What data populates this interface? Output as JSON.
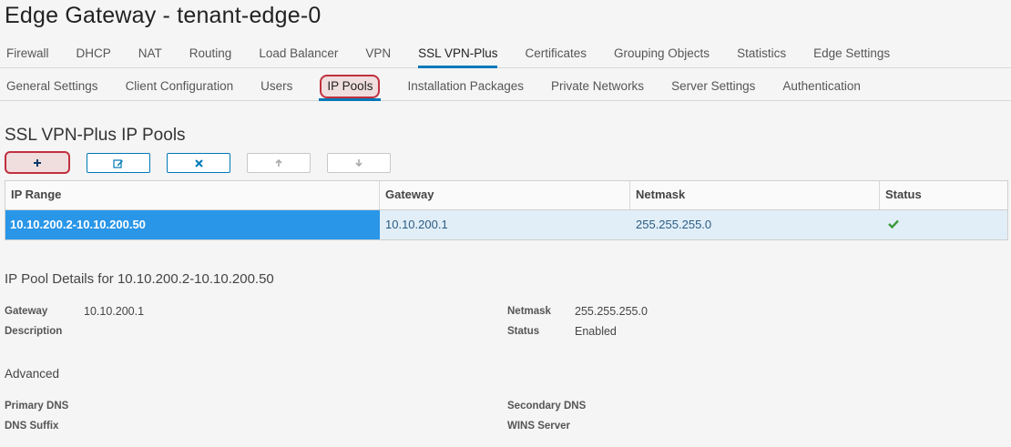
{
  "window": {
    "title": "Edge Gateway - tenant-edge-0"
  },
  "primary_tabs": [
    {
      "label": "Firewall"
    },
    {
      "label": "DHCP"
    },
    {
      "label": "NAT"
    },
    {
      "label": "Routing"
    },
    {
      "label": "Load Balancer"
    },
    {
      "label": "VPN"
    },
    {
      "label": "SSL VPN-Plus"
    },
    {
      "label": "Certificates"
    },
    {
      "label": "Grouping Objects"
    },
    {
      "label": "Statistics"
    },
    {
      "label": "Edge Settings"
    }
  ],
  "secondary_tabs": [
    {
      "label": "General Settings"
    },
    {
      "label": "Client Configuration"
    },
    {
      "label": "Users"
    },
    {
      "label": "IP Pools"
    },
    {
      "label": "Installation Packages"
    },
    {
      "label": "Private Networks"
    },
    {
      "label": "Server Settings"
    },
    {
      "label": "Authentication"
    }
  ],
  "active_primary_tab": "SSL VPN-Plus",
  "active_secondary_tab": "IP Pools",
  "section": {
    "title": "SSL VPN-Plus IP Pools"
  },
  "toolbar": {
    "add_icon": "plus-icon",
    "edit_icon": "edit-icon",
    "delete_icon": "delete-icon",
    "move_up_icon": "arrow-up-icon",
    "move_down_icon": "arrow-down-icon"
  },
  "grid": {
    "columns": [
      "IP Range",
      "Gateway",
      "Netmask",
      "Status"
    ],
    "rows": [
      {
        "ip_range": "10.10.200.2-10.10.200.50",
        "gateway": "10.10.200.1",
        "netmask": "255.255.255.0",
        "status_icon": "check-icon",
        "selected": true
      }
    ]
  },
  "details": {
    "title": "IP Pool Details for 10.10.200.2-10.10.200.50",
    "gateway_label": "Gateway",
    "gateway_value": "10.10.200.1",
    "description_label": "Description",
    "netmask_label": "Netmask",
    "netmask_value": "255.255.255.0",
    "status_label": "Status",
    "status_value": "Enabled",
    "advanced_title": "Advanced",
    "primary_dns_label": "Primary DNS",
    "secondary_dns_label": "Secondary DNS",
    "dns_suffix_label": "DNS Suffix",
    "wins_server_label": "WINS Server"
  },
  "colors": {
    "accent": "#0079b8",
    "selected_row": "#2996e8",
    "highlight_outline": "#c0303f",
    "status_ok": "#3c9a3c"
  }
}
